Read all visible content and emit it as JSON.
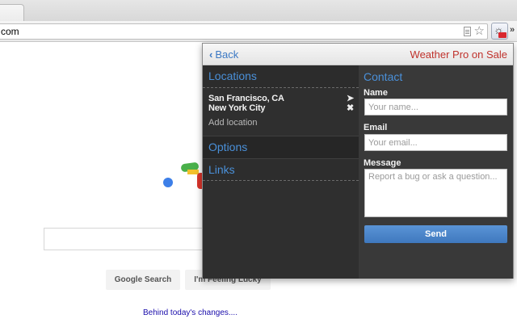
{
  "browser": {
    "url": "com",
    "overflow_chevron": "»",
    "icons": {
      "star": "star-icon",
      "page": "page-icon",
      "extension": "sun-icon"
    }
  },
  "google": {
    "search_button": "Google Search",
    "lucky_button": "I'm Feeling Lucky",
    "doodle_link": "Behind today's changes...."
  },
  "popup": {
    "header": {
      "back_label": "Back",
      "promo_label": "Weather Pro on Sale"
    },
    "locations": {
      "title": "Locations",
      "items": [
        {
          "name": "San Francisco, CA",
          "icon": "location-arrow-icon"
        },
        {
          "name": "New York City",
          "icon": "close-icon"
        }
      ],
      "add_label": "Add location"
    },
    "options_title": "Options",
    "links_title": "Links",
    "contact": {
      "title": "Contact",
      "name_label": "Name",
      "name_placeholder": "Your name...",
      "email_label": "Email",
      "email_placeholder": "Your email...",
      "message_label": "Message",
      "message_placeholder": "Report a bug or ask a question...",
      "send_label": "Send"
    }
  },
  "colors": {
    "accent_blue": "#4a90d9",
    "promo_red": "#c0322c",
    "panel_dark": "#393939",
    "send_button": "#4a86c9"
  }
}
